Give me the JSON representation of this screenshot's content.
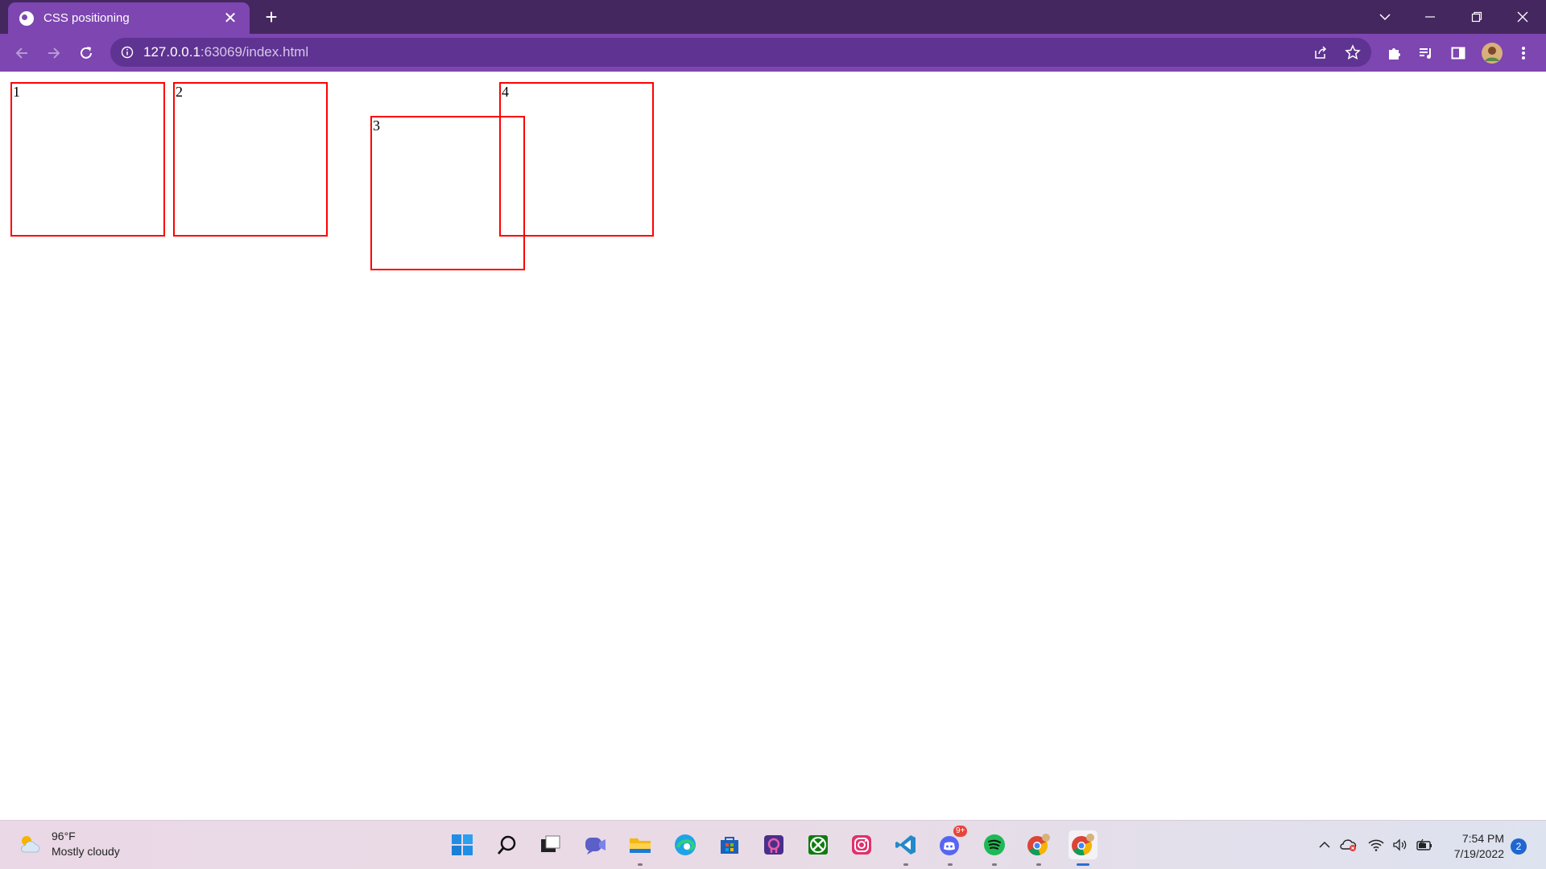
{
  "tab": {
    "title": "CSS positioning",
    "close": "✕"
  },
  "newtab": {
    "label": "+"
  },
  "window_controls": {
    "tab_search": "⌄",
    "minimize": "—",
    "restore": "❐",
    "close": "✕"
  },
  "address": {
    "host": "127.0.0.1",
    "rest": ":63069/index.html"
  },
  "page": {
    "boxes": [
      "1",
      "2",
      "3",
      "4"
    ],
    "border_color": "#ff0000"
  },
  "taskbar": {
    "weather": {
      "temp": "96°F",
      "condition": "Mostly cloudy"
    },
    "apps": [
      "windows-start",
      "search",
      "task-view",
      "teams-chat",
      "file-explorer",
      "edge",
      "microsoft-store",
      "app-pink",
      "xbox",
      "instagram",
      "vscode",
      "discord",
      "spotify",
      "chrome-profile",
      "chrome"
    ],
    "discord_badge": "9+",
    "clock": {
      "time": "7:54 PM",
      "date": "7/19/2022"
    },
    "notifications": "2"
  },
  "colors": {
    "tabstrip": "#45275f",
    "toolbar": "#7d46b1",
    "omnibox": "#5f3392"
  }
}
